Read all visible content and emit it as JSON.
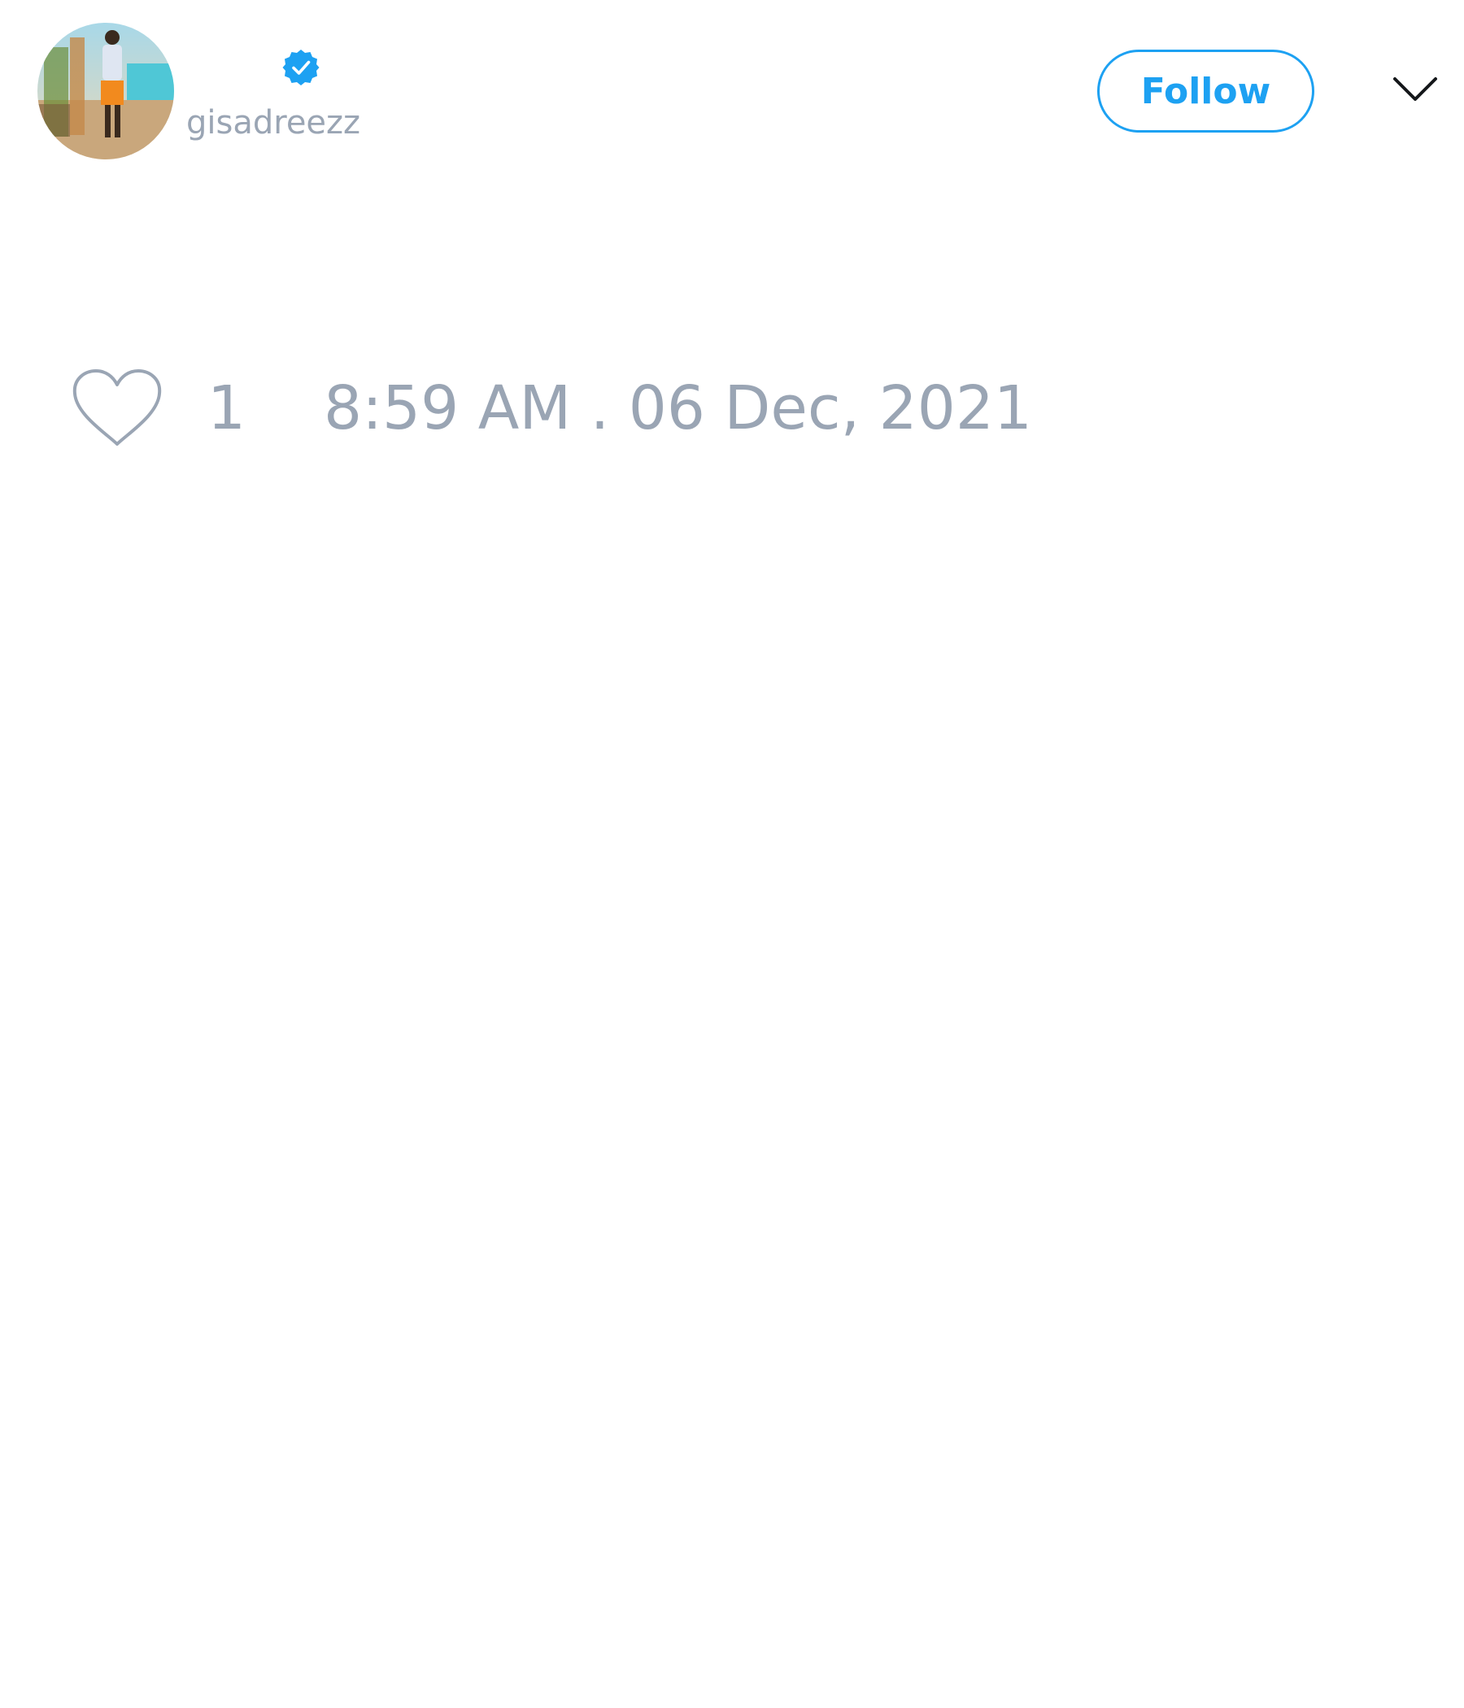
{
  "author": {
    "display_name": "",
    "handle": "gisadreezz",
    "verified": true,
    "avatar_icon": "profile-photo"
  },
  "actions": {
    "follow_label": "Follow",
    "menu_icon": "chevron-down-icon"
  },
  "tweet": {
    "like_icon": "heart-outline-icon",
    "like_count": "1",
    "timestamp": "8:59 AM . 06 Dec, 2021"
  },
  "colors": {
    "accent": "#1da1f2",
    "muted_text": "#9aa5b4",
    "background": "#ffffff"
  }
}
